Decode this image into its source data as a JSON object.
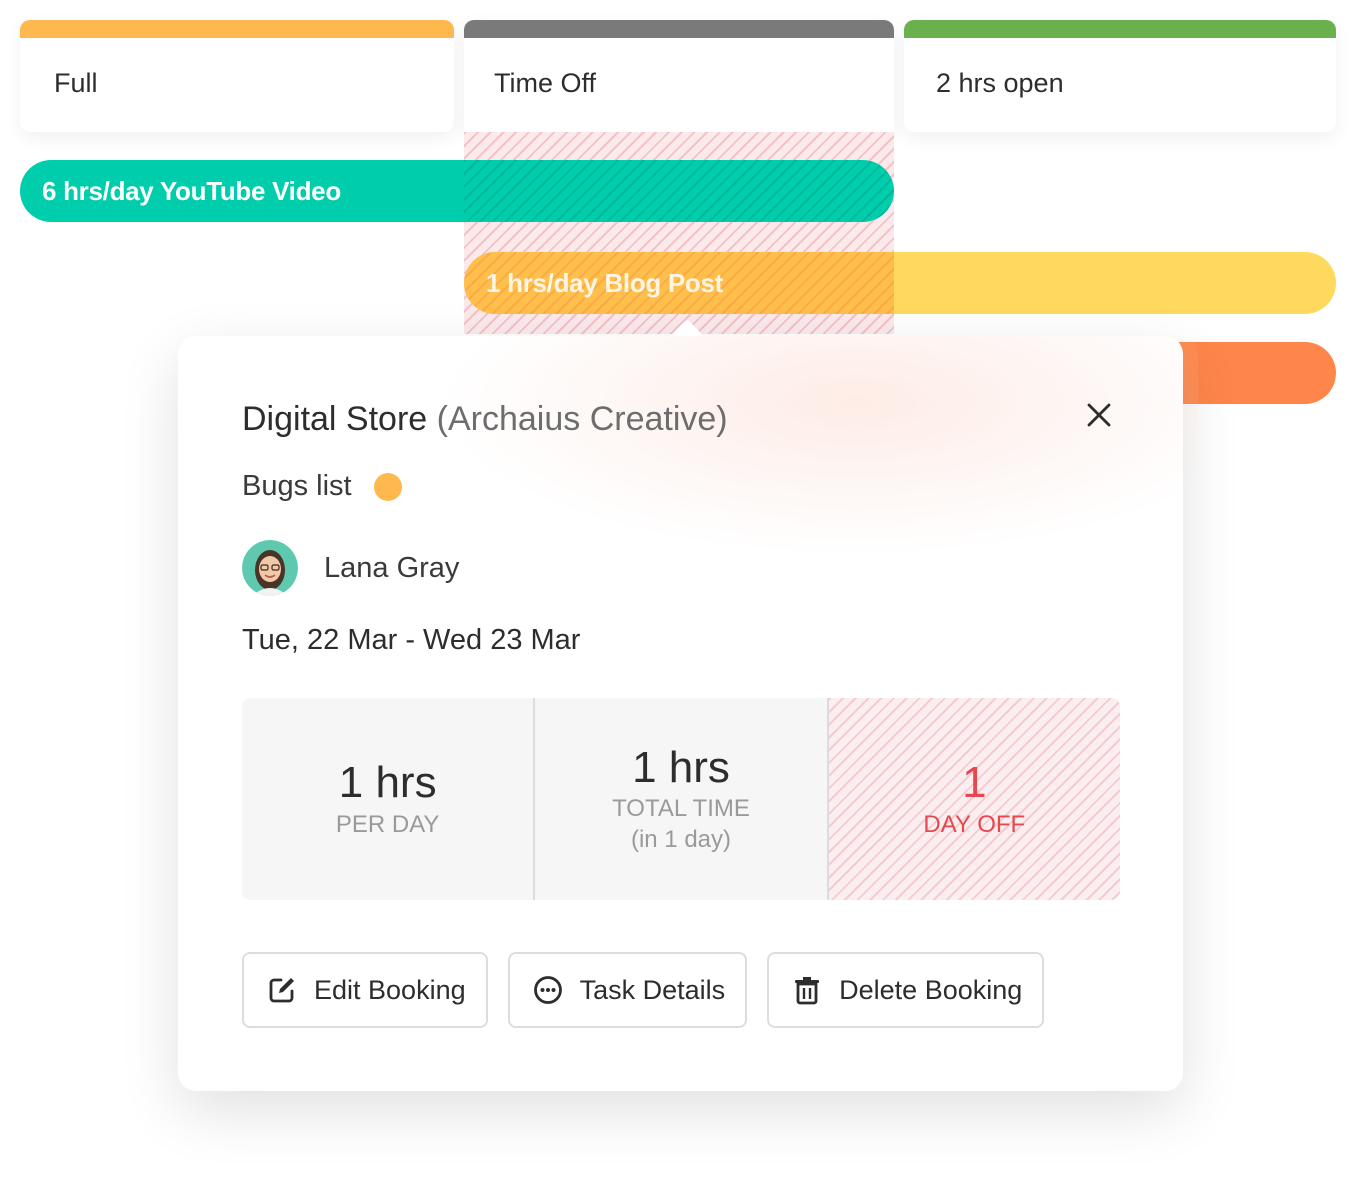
{
  "days": [
    {
      "label": "Full",
      "color": "#ffb84d"
    },
    {
      "label": "Time Off",
      "color": "#7a7a7a"
    },
    {
      "label": "2 hrs open",
      "color": "#6ab04c"
    }
  ],
  "bookings": [
    {
      "label": "6 hrs/day YouTube Video",
      "color": "#00cdac"
    },
    {
      "label": "1 hrs/day Blog Post",
      "color": "#ffd95e"
    },
    {
      "label": "",
      "color": "#ff864a"
    }
  ],
  "popup": {
    "project": "Digital Store",
    "client": "(Archaius Creative)",
    "task": "Bugs list",
    "task_color": "#ffb84d",
    "person": "Lana Gray",
    "dates": "Tue, 22 Mar - Wed 23 Mar",
    "stats": {
      "per_day_value": "1 hrs",
      "per_day_label": "PER DAY",
      "total_value": "1 hrs",
      "total_label": "TOTAL TIME",
      "total_sub": "(in 1 day)",
      "off_value": "1",
      "off_label": "DAY OFF"
    },
    "actions": {
      "edit": "Edit Booking",
      "details": "Task Details",
      "delete": "Delete Booking"
    }
  },
  "icons": [
    "close-icon",
    "edit-icon",
    "more-icon",
    "trash-icon",
    "avatar"
  ]
}
